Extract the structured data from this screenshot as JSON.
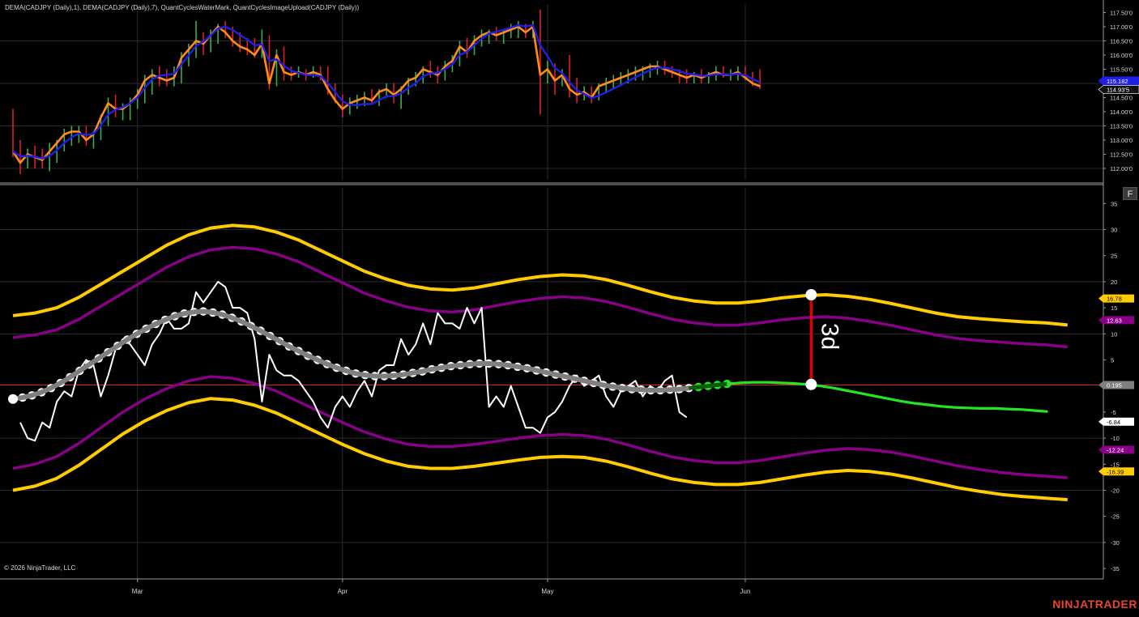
{
  "legend_text": "DEMA(CADJPY (Daily),1), DEMA(CADJPY (Daily),7), QuantCyclesWaterMark, QuantCyclesImageUpload(CADJPY (Daily))",
  "copyright": "© 2026 NinjaTrader, LLC",
  "brand": "NINJATRADER",
  "panel_button": "F",
  "annotation_text": "3d",
  "colors": {
    "background": "#000000",
    "grid": "#2b2b2b",
    "dema_fast": "#ff8c1a",
    "dema_slow": "#1f1fe6",
    "bar_up": "#3cb043",
    "bar_down": "#e02020",
    "cycle_gray": "#7f7f7f",
    "cycle_projection": "#22e622",
    "band_outer": "#ffcc00",
    "band_inner": "#8b008b",
    "oscillator": "#ffffff",
    "zero_line": "#e02020",
    "annotation": "#e00000"
  },
  "chart_data": [
    {
      "type": "line",
      "panel": "price",
      "symbol": "CADJPY (Daily)",
      "ylim": [
        111.6,
        117.8
      ],
      "yticks": [
        112.0,
        112.5,
        113.0,
        113.5,
        114.0,
        114.5,
        115.0,
        115.5,
        116.0,
        116.5,
        117.0,
        117.5
      ],
      "ytick_labels": [
        "112.00'0",
        "112.50'0",
        "113.00'0",
        "113.50'0",
        "114.00'0",
        "114.50'0",
        "115.00'0",
        "115.50'0",
        "116.00'0",
        "116.50'0",
        "117.00'0",
        "117.50'0"
      ],
      "xtick_labels": [
        "Mar",
        "Apr",
        "May",
        "Jun"
      ],
      "xtick_bar_index": [
        17,
        45,
        73,
        100
      ],
      "last_value_labels": [
        {
          "text": "115.182",
          "color": "#1f1fe6"
        },
        {
          "text": "114.93'5",
          "color": "#e6e6e6"
        }
      ],
      "bars": [
        {
          "o": 113.9,
          "h": 114.1,
          "l": 112.4,
          "c": 112.6
        },
        {
          "o": 112.6,
          "h": 113.0,
          "l": 111.8,
          "c": 112.2
        },
        {
          "o": 112.2,
          "h": 112.7,
          "l": 112.0,
          "c": 112.5
        },
        {
          "o": 112.5,
          "h": 112.8,
          "l": 112.0,
          "c": 112.4
        },
        {
          "o": 112.4,
          "h": 112.7,
          "l": 112.0,
          "c": 112.3
        },
        {
          "o": 112.3,
          "h": 112.9,
          "l": 111.9,
          "c": 112.6
        },
        {
          "o": 112.6,
          "h": 113.0,
          "l": 112.2,
          "c": 112.9
        },
        {
          "o": 112.9,
          "h": 113.4,
          "l": 112.6,
          "c": 113.2
        },
        {
          "o": 113.2,
          "h": 113.5,
          "l": 112.8,
          "c": 113.3
        },
        {
          "o": 113.3,
          "h": 113.5,
          "l": 112.9,
          "c": 113.3
        },
        {
          "o": 113.3,
          "h": 113.5,
          "l": 112.8,
          "c": 113.0
        },
        {
          "o": 113.0,
          "h": 113.3,
          "l": 112.7,
          "c": 113.2
        },
        {
          "o": 113.2,
          "h": 113.9,
          "l": 113.0,
          "c": 113.8
        },
        {
          "o": 113.8,
          "h": 114.5,
          "l": 113.5,
          "c": 114.3
        },
        {
          "o": 114.3,
          "h": 114.6,
          "l": 113.8,
          "c": 114.1
        },
        {
          "o": 114.1,
          "h": 114.3,
          "l": 113.7,
          "c": 114.1
        },
        {
          "o": 114.1,
          "h": 114.5,
          "l": 113.7,
          "c": 114.3
        },
        {
          "o": 114.3,
          "h": 114.8,
          "l": 114.1,
          "c": 114.6
        },
        {
          "o": 114.6,
          "h": 115.3,
          "l": 114.3,
          "c": 115.1
        },
        {
          "o": 115.1,
          "h": 115.5,
          "l": 114.6,
          "c": 115.3
        },
        {
          "o": 115.3,
          "h": 115.6,
          "l": 114.9,
          "c": 115.2
        },
        {
          "o": 115.2,
          "h": 115.5,
          "l": 114.9,
          "c": 115.1
        },
        {
          "o": 115.1,
          "h": 115.6,
          "l": 114.9,
          "c": 115.2
        },
        {
          "o": 115.2,
          "h": 116.1,
          "l": 115.0,
          "c": 115.9
        },
        {
          "o": 115.9,
          "h": 116.4,
          "l": 115.6,
          "c": 116.2
        },
        {
          "o": 116.2,
          "h": 117.2,
          "l": 115.9,
          "c": 116.5
        },
        {
          "o": 116.5,
          "h": 116.8,
          "l": 116.0,
          "c": 116.4
        },
        {
          "o": 116.4,
          "h": 116.9,
          "l": 116.1,
          "c": 116.7
        },
        {
          "o": 116.7,
          "h": 117.1,
          "l": 116.4,
          "c": 117.0
        },
        {
          "o": 117.0,
          "h": 117.2,
          "l": 116.6,
          "c": 116.8
        },
        {
          "o": 116.8,
          "h": 117.0,
          "l": 116.3,
          "c": 116.5
        },
        {
          "o": 116.5,
          "h": 116.8,
          "l": 116.1,
          "c": 116.3
        },
        {
          "o": 116.3,
          "h": 116.6,
          "l": 116.0,
          "c": 116.2
        },
        {
          "o": 116.2,
          "h": 116.6,
          "l": 115.9,
          "c": 116.0
        },
        {
          "o": 116.0,
          "h": 116.9,
          "l": 115.9,
          "c": 116.4
        },
        {
          "o": 116.4,
          "h": 116.7,
          "l": 114.8,
          "c": 115.0
        },
        {
          "o": 115.0,
          "h": 116.2,
          "l": 114.9,
          "c": 116.0
        },
        {
          "o": 116.0,
          "h": 116.3,
          "l": 115.1,
          "c": 115.4
        },
        {
          "o": 115.4,
          "h": 115.6,
          "l": 115.1,
          "c": 115.3
        },
        {
          "o": 115.3,
          "h": 115.6,
          "l": 115.2,
          "c": 115.4
        },
        {
          "o": 115.4,
          "h": 115.5,
          "l": 115.1,
          "c": 115.3
        },
        {
          "o": 115.3,
          "h": 115.6,
          "l": 115.2,
          "c": 115.4
        },
        {
          "o": 115.4,
          "h": 115.6,
          "l": 115.1,
          "c": 115.3
        },
        {
          "o": 115.3,
          "h": 115.6,
          "l": 114.6,
          "c": 114.8
        },
        {
          "o": 114.8,
          "h": 115.0,
          "l": 114.3,
          "c": 114.4
        },
        {
          "o": 114.4,
          "h": 114.6,
          "l": 113.8,
          "c": 114.1
        },
        {
          "o": 114.1,
          "h": 114.5,
          "l": 113.9,
          "c": 114.3
        },
        {
          "o": 114.3,
          "h": 114.6,
          "l": 114.1,
          "c": 114.4
        },
        {
          "o": 114.4,
          "h": 114.7,
          "l": 114.2,
          "c": 114.5
        },
        {
          "o": 114.5,
          "h": 114.8,
          "l": 114.3,
          "c": 114.4
        },
        {
          "o": 114.4,
          "h": 114.8,
          "l": 114.2,
          "c": 114.7
        },
        {
          "o": 114.7,
          "h": 115.0,
          "l": 114.5,
          "c": 114.8
        },
        {
          "o": 114.8,
          "h": 115.0,
          "l": 114.3,
          "c": 114.6
        },
        {
          "o": 114.6,
          "h": 114.9,
          "l": 114.1,
          "c": 114.8
        },
        {
          "o": 114.8,
          "h": 115.2,
          "l": 114.6,
          "c": 115.1
        },
        {
          "o": 115.1,
          "h": 115.4,
          "l": 114.9,
          "c": 115.2
        },
        {
          "o": 115.2,
          "h": 115.6,
          "l": 115.0,
          "c": 115.5
        },
        {
          "o": 115.5,
          "h": 115.8,
          "l": 115.2,
          "c": 115.4
        },
        {
          "o": 115.4,
          "h": 115.6,
          "l": 115.0,
          "c": 115.3
        },
        {
          "o": 115.3,
          "h": 115.8,
          "l": 115.1,
          "c": 115.6
        },
        {
          "o": 115.6,
          "h": 116.0,
          "l": 115.4,
          "c": 115.8
        },
        {
          "o": 115.8,
          "h": 116.5,
          "l": 115.6,
          "c": 116.3
        },
        {
          "o": 116.3,
          "h": 116.6,
          "l": 115.9,
          "c": 116.1
        },
        {
          "o": 116.1,
          "h": 116.7,
          "l": 116.0,
          "c": 116.5
        },
        {
          "o": 116.5,
          "h": 116.9,
          "l": 116.3,
          "c": 116.7
        },
        {
          "o": 116.7,
          "h": 116.9,
          "l": 116.4,
          "c": 116.8
        },
        {
          "o": 116.8,
          "h": 117.0,
          "l": 116.5,
          "c": 116.7
        },
        {
          "o": 116.7,
          "h": 116.9,
          "l": 116.4,
          "c": 116.8
        },
        {
          "o": 116.8,
          "h": 117.1,
          "l": 116.6,
          "c": 116.9
        },
        {
          "o": 116.9,
          "h": 117.2,
          "l": 116.6,
          "c": 117.0
        },
        {
          "o": 117.0,
          "h": 117.1,
          "l": 116.6,
          "c": 116.8
        },
        {
          "o": 116.8,
          "h": 117.2,
          "l": 116.6,
          "c": 117.0
        },
        {
          "o": 117.0,
          "h": 117.6,
          "l": 113.9,
          "c": 115.3
        },
        {
          "o": 115.3,
          "h": 115.8,
          "l": 115.0,
          "c": 115.5
        },
        {
          "o": 115.5,
          "h": 115.7,
          "l": 114.6,
          "c": 115.1
        },
        {
          "o": 115.1,
          "h": 115.5,
          "l": 114.9,
          "c": 115.3
        },
        {
          "o": 115.3,
          "h": 116.0,
          "l": 114.5,
          "c": 114.8
        },
        {
          "o": 114.8,
          "h": 115.2,
          "l": 114.3,
          "c": 114.6
        },
        {
          "o": 114.6,
          "h": 114.9,
          "l": 114.4,
          "c": 114.7
        },
        {
          "o": 114.7,
          "h": 114.9,
          "l": 114.3,
          "c": 114.5
        },
        {
          "o": 114.5,
          "h": 115.0,
          "l": 114.4,
          "c": 114.9
        },
        {
          "o": 114.9,
          "h": 115.2,
          "l": 114.7,
          "c": 115.0
        },
        {
          "o": 115.0,
          "h": 115.3,
          "l": 114.8,
          "c": 115.1
        },
        {
          "o": 115.1,
          "h": 115.4,
          "l": 114.9,
          "c": 115.2
        },
        {
          "o": 115.2,
          "h": 115.5,
          "l": 115.0,
          "c": 115.3
        },
        {
          "o": 115.3,
          "h": 115.6,
          "l": 115.1,
          "c": 115.4
        },
        {
          "o": 115.4,
          "h": 115.6,
          "l": 115.1,
          "c": 115.5
        },
        {
          "o": 115.5,
          "h": 115.7,
          "l": 115.2,
          "c": 115.6
        },
        {
          "o": 115.6,
          "h": 115.8,
          "l": 115.3,
          "c": 115.6
        },
        {
          "o": 115.6,
          "h": 115.8,
          "l": 115.3,
          "c": 115.5
        },
        {
          "o": 115.5,
          "h": 115.6,
          "l": 115.2,
          "c": 115.4
        },
        {
          "o": 115.4,
          "h": 115.5,
          "l": 115.0,
          "c": 115.3
        },
        {
          "o": 115.3,
          "h": 115.5,
          "l": 115.0,
          "c": 115.2
        },
        {
          "o": 115.2,
          "h": 115.4,
          "l": 115.0,
          "c": 115.3
        },
        {
          "o": 115.3,
          "h": 115.5,
          "l": 115.0,
          "c": 115.2
        },
        {
          "o": 115.2,
          "h": 115.4,
          "l": 115.0,
          "c": 115.3
        },
        {
          "o": 115.3,
          "h": 115.6,
          "l": 115.1,
          "c": 115.4
        },
        {
          "o": 115.4,
          "h": 115.6,
          "l": 115.2,
          "c": 115.3
        },
        {
          "o": 115.3,
          "h": 115.5,
          "l": 115.1,
          "c": 115.3
        },
        {
          "o": 115.3,
          "h": 115.6,
          "l": 115.1,
          "c": 115.4
        },
        {
          "o": 115.4,
          "h": 115.6,
          "l": 115.1,
          "c": 115.2
        },
        {
          "o": 115.2,
          "h": 115.4,
          "l": 114.9,
          "c": 115.0
        },
        {
          "o": 115.0,
          "h": 115.5,
          "l": 114.8,
          "c": 114.9
        }
      ]
    },
    {
      "type": "line",
      "panel": "cycle_oscillator",
      "ylim": [
        -37,
        38
      ],
      "yticks": [
        -35,
        -30,
        -25,
        -20,
        -15,
        -10,
        -5,
        0,
        5,
        10,
        15,
        20,
        25,
        30,
        35
      ],
      "ytick_labels": [
        "-35",
        "-30",
        "-25",
        "-20",
        "-15",
        "-10",
        "-5",
        "0",
        "5",
        "10",
        "15",
        "20",
        "25",
        "30",
        "35"
      ],
      "zero_line_value": 0.195,
      "value_labels": [
        {
          "text": "16.78",
          "color": "#ffcc00"
        },
        {
          "text": "12.63",
          "color": "#8b008b"
        },
        {
          "text": "0.195",
          "color": "#7f7f7f"
        },
        {
          "text": "-6.84",
          "color": "#ffffff"
        },
        {
          "text": "-12.24",
          "color": "#8b008b"
        },
        {
          "text": "-16.39",
          "color": "#ffcc00"
        }
      ],
      "annotation": {
        "text": "3d",
        "bar_index": 109,
        "y_from": 0.3,
        "y_to": 17.5
      },
      "oscillator": [
        -7,
        -10,
        -10.5,
        -7,
        -8,
        -3,
        -1,
        -2,
        3,
        5,
        4,
        -2,
        2,
        7,
        9,
        8,
        6,
        4,
        8,
        10,
        13,
        11,
        11,
        12,
        18,
        16,
        18,
        20,
        19,
        15,
        15,
        14,
        9,
        -3,
        6,
        3,
        2,
        2,
        1,
        -1,
        -3,
        -6,
        -8,
        -4,
        -2,
        -4,
        -1,
        1,
        -2,
        3,
        4,
        4,
        9,
        6,
        8,
        12,
        8,
        14,
        12,
        12,
        11,
        15,
        12,
        15,
        -4,
        -2,
        -4,
        0,
        -4,
        -8,
        -8,
        -9,
        -6,
        -5,
        -3,
        0,
        2,
        0,
        1,
        2,
        -2,
        -4,
        -1,
        0,
        1,
        -2,
        0,
        -1,
        1,
        2,
        -5,
        -6
      ],
      "osc_start_index": 1,
      "cycle": [
        -2.5,
        -2.2,
        -1.8,
        -1.2,
        -0.4,
        0.6,
        1.7,
        2.9,
        4.1,
        5.3,
        6.5,
        7.7,
        8.9,
        10.0,
        11.0,
        11.9,
        12.7,
        13.4,
        13.9,
        14.2,
        14.3,
        14.1,
        13.7,
        13.1,
        12.4,
        11.5,
        10.6,
        9.6,
        8.6,
        7.6,
        6.7,
        5.8,
        5.0,
        4.2,
        3.5,
        2.9,
        2.4,
        2.1,
        1.9,
        1.9,
        2.0,
        2.2,
        2.5,
        2.8,
        3.2,
        3.5,
        3.8,
        4.0,
        4.2,
        4.3,
        4.3,
        4.2,
        4.0,
        3.7,
        3.4,
        3.0,
        2.6,
        2.2,
        1.8,
        1.4,
        1.0,
        0.6,
        0.2,
        -0.1,
        -0.4,
        -0.6,
        -0.7,
        -0.8,
        -0.8,
        -0.7,
        -0.6,
        -0.4,
        -0.2,
        0.0,
        0.2,
        0.4
      ],
      "cycle_gray_end_index": 92,
      "cycle_projection": [
        0.4,
        0.6,
        0.7,
        0.7,
        0.6,
        0.5,
        0.3,
        0.0,
        -0.4,
        -0.9,
        -1.4,
        -1.9,
        -2.4,
        -2.9,
        -3.3,
        -3.6,
        -3.9,
        -4.1,
        -4.2,
        -4.3,
        -4.3,
        -4.4,
        -4.5,
        -4.7,
        -4.9
      ],
      "outer_upper": [
        13.5,
        14.0,
        15.0,
        17.0,
        19.5,
        22.0,
        24.5,
        27.0,
        29.0,
        30.3,
        30.8,
        30.5,
        29.5,
        28.0,
        26.0,
        24.0,
        22.0,
        20.5,
        19.3,
        18.6,
        18.4,
        18.8,
        19.6,
        20.4,
        21.0,
        21.3,
        21.1,
        20.4,
        19.3,
        18.1,
        17.0,
        16.3,
        15.9,
        15.9,
        16.3,
        16.9,
        17.3,
        17.5,
        17.2,
        16.6,
        15.8,
        14.9,
        14.0,
        13.3,
        12.9,
        12.6,
        12.3,
        12.1,
        11.7
      ],
      "inner_upper": [
        9.3,
        9.8,
        10.8,
        12.8,
        15.3,
        17.8,
        20.3,
        22.8,
        24.8,
        26.1,
        26.6,
        26.3,
        25.3,
        23.8,
        21.8,
        19.8,
        17.8,
        16.3,
        15.1,
        14.4,
        14.2,
        14.6,
        15.4,
        16.2,
        16.8,
        17.1,
        16.9,
        16.2,
        15.1,
        13.9,
        12.8,
        12.1,
        11.7,
        11.7,
        12.1,
        12.7,
        13.1,
        13.3,
        13.0,
        12.4,
        11.6,
        10.7,
        9.8,
        9.1,
        8.7,
        8.4,
        8.1,
        7.9,
        7.5
      ],
      "inner_lower": [
        -15.8,
        -15.0,
        -13.5,
        -11.0,
        -8.0,
        -5.0,
        -2.5,
        -0.5,
        1.0,
        1.8,
        1.5,
        0.5,
        -1.0,
        -3.0,
        -5.0,
        -7.0,
        -8.8,
        -10.2,
        -11.2,
        -11.6,
        -11.6,
        -11.2,
        -10.6,
        -10.0,
        -9.5,
        -9.3,
        -9.5,
        -10.2,
        -11.3,
        -12.5,
        -13.6,
        -14.3,
        -14.7,
        -14.7,
        -14.3,
        -13.6,
        -12.9,
        -12.3,
        -12.0,
        -12.2,
        -12.7,
        -13.5,
        -14.4,
        -15.3,
        -16.0,
        -16.6,
        -17.0,
        -17.3,
        -17.6
      ],
      "outer_lower": [
        -20.0,
        -19.2,
        -17.7,
        -15.2,
        -12.2,
        -9.2,
        -6.7,
        -4.7,
        -3.2,
        -2.4,
        -2.7,
        -3.7,
        -5.2,
        -7.2,
        -9.2,
        -11.2,
        -13.0,
        -14.4,
        -15.4,
        -15.8,
        -15.8,
        -15.4,
        -14.8,
        -14.2,
        -13.7,
        -13.5,
        -13.7,
        -14.4,
        -15.5,
        -16.7,
        -17.8,
        -18.5,
        -18.9,
        -18.9,
        -18.5,
        -17.8,
        -17.1,
        -16.5,
        -16.2,
        -16.4,
        -16.9,
        -17.7,
        -18.6,
        -19.5,
        -20.2,
        -20.8,
        -21.2,
        -21.5,
        -21.8
      ]
    }
  ]
}
